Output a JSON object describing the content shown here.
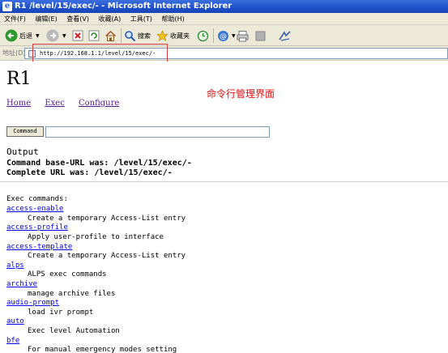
{
  "window": {
    "title": "R1 /level/15/exec/- - Microsoft Internet Explorer"
  },
  "menu": [
    "文件(F)",
    "编辑(E)",
    "查看(V)",
    "收藏(A)",
    "工具(T)",
    "帮助(H)"
  ],
  "toolbar": {
    "back_label": "后退",
    "search_label": "搜索",
    "favorites_label": "收藏夹"
  },
  "address": {
    "label": "地址(D)",
    "url": "http://192.168.1.1/level/15/exec/-"
  },
  "page": {
    "title": "R1",
    "annotation": "命令行管理界面",
    "links": [
      "Home",
      "Exec",
      "Configure"
    ],
    "command_button": "Command",
    "command_value": "",
    "output_heading": "Output",
    "output_lines": [
      "Command base-URL was: /level/15/exec/-",
      "Complete URL was: /level/15/exec/-"
    ],
    "exec_heading": "Exec commands:",
    "commands": [
      {
        "name": "access-enable",
        "desc": "Create a temporary Access-List entry"
      },
      {
        "name": "access-profile",
        "desc": "Apply user-profile to interface"
      },
      {
        "name": "access-template",
        "desc": "Create a temporary Access-List entry"
      },
      {
        "name": "alps",
        "desc": "ALPS exec commands"
      },
      {
        "name": "archive",
        "desc": "manage archive files"
      },
      {
        "name": "audio-prompt",
        "desc": "load ivr prompt"
      },
      {
        "name": "auto",
        "desc": "Exec level Automation"
      },
      {
        "name": "bfe",
        "desc": "For manual emergency modes setting"
      }
    ]
  }
}
